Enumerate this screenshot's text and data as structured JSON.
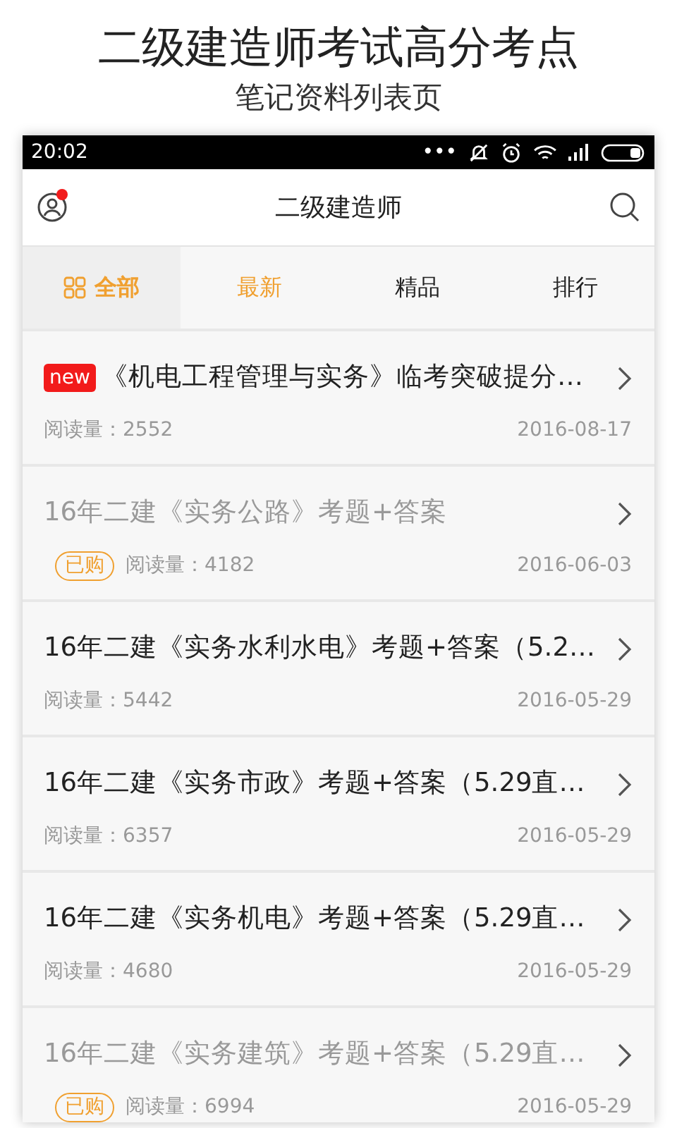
{
  "promo": {
    "title": "二级建造师考试高分考点",
    "subtitle": "笔记资料列表页"
  },
  "status_bar": {
    "time": "20:02",
    "dots": "•••"
  },
  "header": {
    "title": "二级建造师",
    "notification": true
  },
  "tabs": [
    {
      "label": "全部",
      "selected": true,
      "accent": true,
      "icon": true
    },
    {
      "label": "最新",
      "selected": false,
      "accent": true,
      "icon": false
    },
    {
      "label": "精品",
      "selected": false,
      "accent": false,
      "icon": false
    },
    {
      "label": "排行",
      "selected": false,
      "accent": false,
      "icon": false
    }
  ],
  "items": [
    {
      "title": "《机电工程管理与实务》临考突破提分…",
      "new": true,
      "new_label": "new",
      "purchased": false,
      "reads": "阅读量：2552",
      "date": "2016-08-17"
    },
    {
      "title": "16年二建《实务公路》考题+答案",
      "new": false,
      "purchased": true,
      "purchased_label": "已购",
      "reads": "阅读量：4182",
      "date": "2016-06-03"
    },
    {
      "title": "16年二建《实务水利水电》考题+答案（5.2…",
      "new": false,
      "purchased": false,
      "reads": "阅读量：5442",
      "date": "2016-05-29"
    },
    {
      "title": "16年二建《实务市政》考题+答案（5.29直…",
      "new": false,
      "purchased": false,
      "reads": "阅读量：6357",
      "date": "2016-05-29"
    },
    {
      "title": "16年二建《实务机电》考题+答案（5.29直…",
      "new": false,
      "purchased": false,
      "reads": "阅读量：4680",
      "date": "2016-05-29"
    },
    {
      "title": "16年二建《实务建筑》考题+答案（5.29直…",
      "new": false,
      "purchased": true,
      "purchased_label": "已购",
      "reads": "阅读量：6994",
      "date": "2016-05-29"
    }
  ]
}
